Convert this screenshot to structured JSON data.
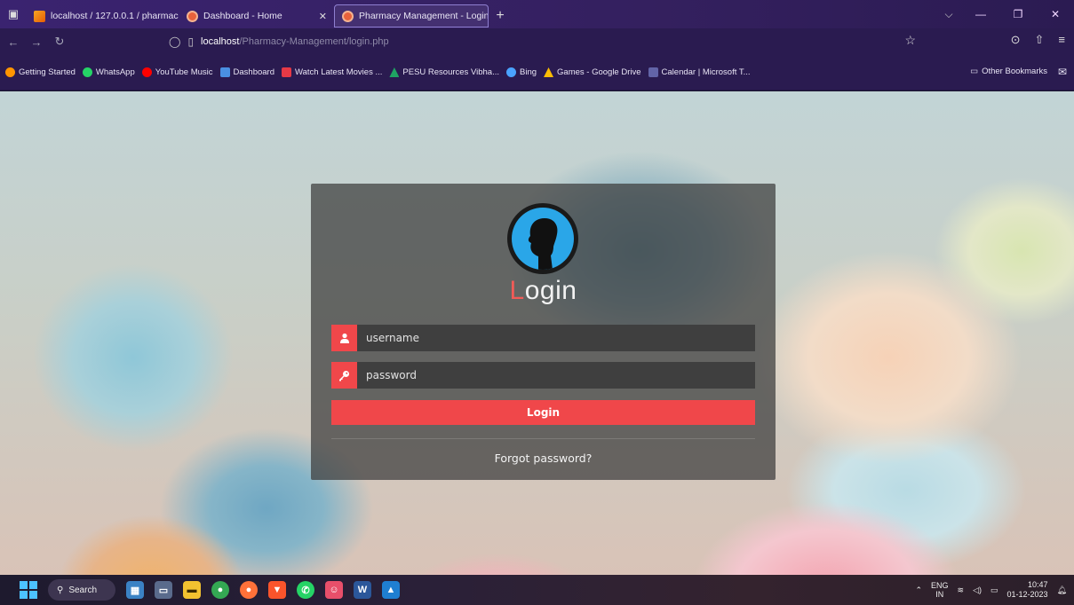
{
  "browser": {
    "tabs": [
      {
        "title": "localhost / 127.0.0.1 / pharmac"
      },
      {
        "title": "Dashboard - Home"
      },
      {
        "title": "Pharmacy Management - Login"
      }
    ],
    "url_host": "localhost",
    "url_path": "/Pharmacy-Management/login.php",
    "bookmarks": [
      {
        "label": "Getting Started",
        "color": "#ff9500"
      },
      {
        "label": "WhatsApp",
        "color": "#25d366"
      },
      {
        "label": "YouTube Music",
        "color": "#ff0000"
      },
      {
        "label": "Dashboard",
        "color": "#4a90e2"
      },
      {
        "label": "Watch Latest Movies ...",
        "color": "#e63946"
      },
      {
        "label": "PESU Resources Vibha...",
        "color": "#1fa463"
      },
      {
        "label": "Bing",
        "color": "#4aa3ff"
      },
      {
        "label": "Games - Google Drive",
        "color": "#fbbc04"
      },
      {
        "label": "Calendar | Microsoft T...",
        "color": "#6264a7"
      }
    ],
    "other_bookmarks": "Other Bookmarks"
  },
  "login": {
    "title_first": "L",
    "title_rest": "ogin",
    "username_placeholder": "username",
    "password_placeholder": "password",
    "login_button": "Login",
    "forgot_link": "Forgot password?"
  },
  "colors": {
    "accent": "#f0474a",
    "avatar_bg": "#2aa6e8"
  },
  "taskbar": {
    "search_label": "Search",
    "lang_top": "ENG",
    "lang_bottom": "IN",
    "time": "10:47",
    "date": "01-12-2023"
  }
}
